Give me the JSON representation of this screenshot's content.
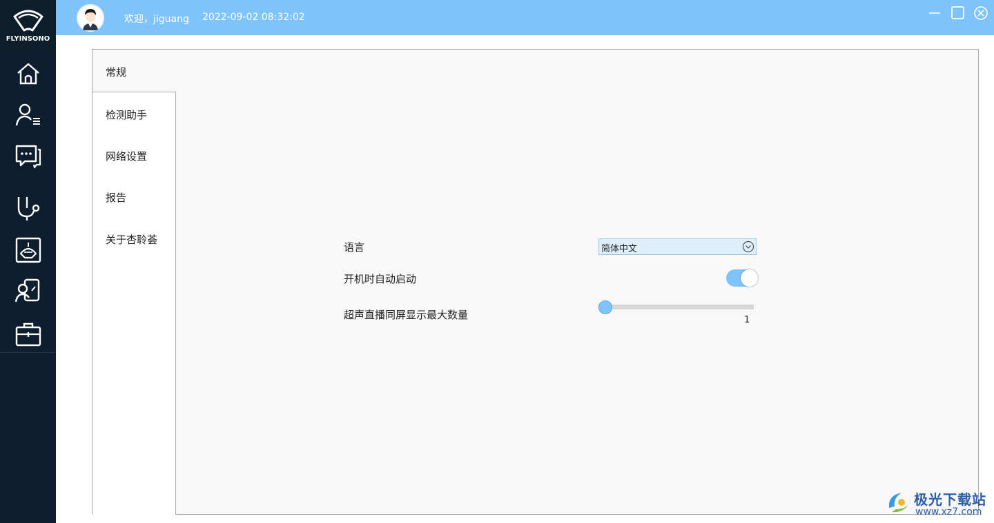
{
  "brand": {
    "logo_text": "FLYINSONO"
  },
  "nav": {
    "items": [
      {
        "name": "home",
        "icon": "home-icon"
      },
      {
        "name": "patients",
        "icon": "user-list-icon"
      },
      {
        "name": "messages",
        "icon": "chat-icon"
      },
      {
        "name": "stethoscope",
        "icon": "stethoscope-icon"
      },
      {
        "name": "ultrasound",
        "icon": "ultrasound-icon"
      },
      {
        "name": "consult",
        "icon": "doctor-icon"
      },
      {
        "name": "toolbox",
        "icon": "toolbox-icon"
      }
    ]
  },
  "header": {
    "welcome": "欢迎，jiguang",
    "datetime": "2022-09-02 08:32:02",
    "accent_color": "#7ec4fb"
  },
  "tabs": [
    {
      "label": "常规",
      "active": true
    },
    {
      "label": "检测助手",
      "active": false
    },
    {
      "label": "网络设置",
      "active": false
    },
    {
      "label": "报告",
      "active": false
    },
    {
      "label": "关于杏聆荟",
      "active": false
    }
  ],
  "settings": {
    "language": {
      "label": "语言",
      "value": "简体中文"
    },
    "autostart": {
      "label": "开机时自动启动",
      "enabled": true
    },
    "max_screens": {
      "label": "超声直播同屏显示最大数量",
      "value": "1",
      "fraction": 0
    }
  },
  "watermark": {
    "text": "极光下载站",
    "url": "www.xz7.com"
  }
}
